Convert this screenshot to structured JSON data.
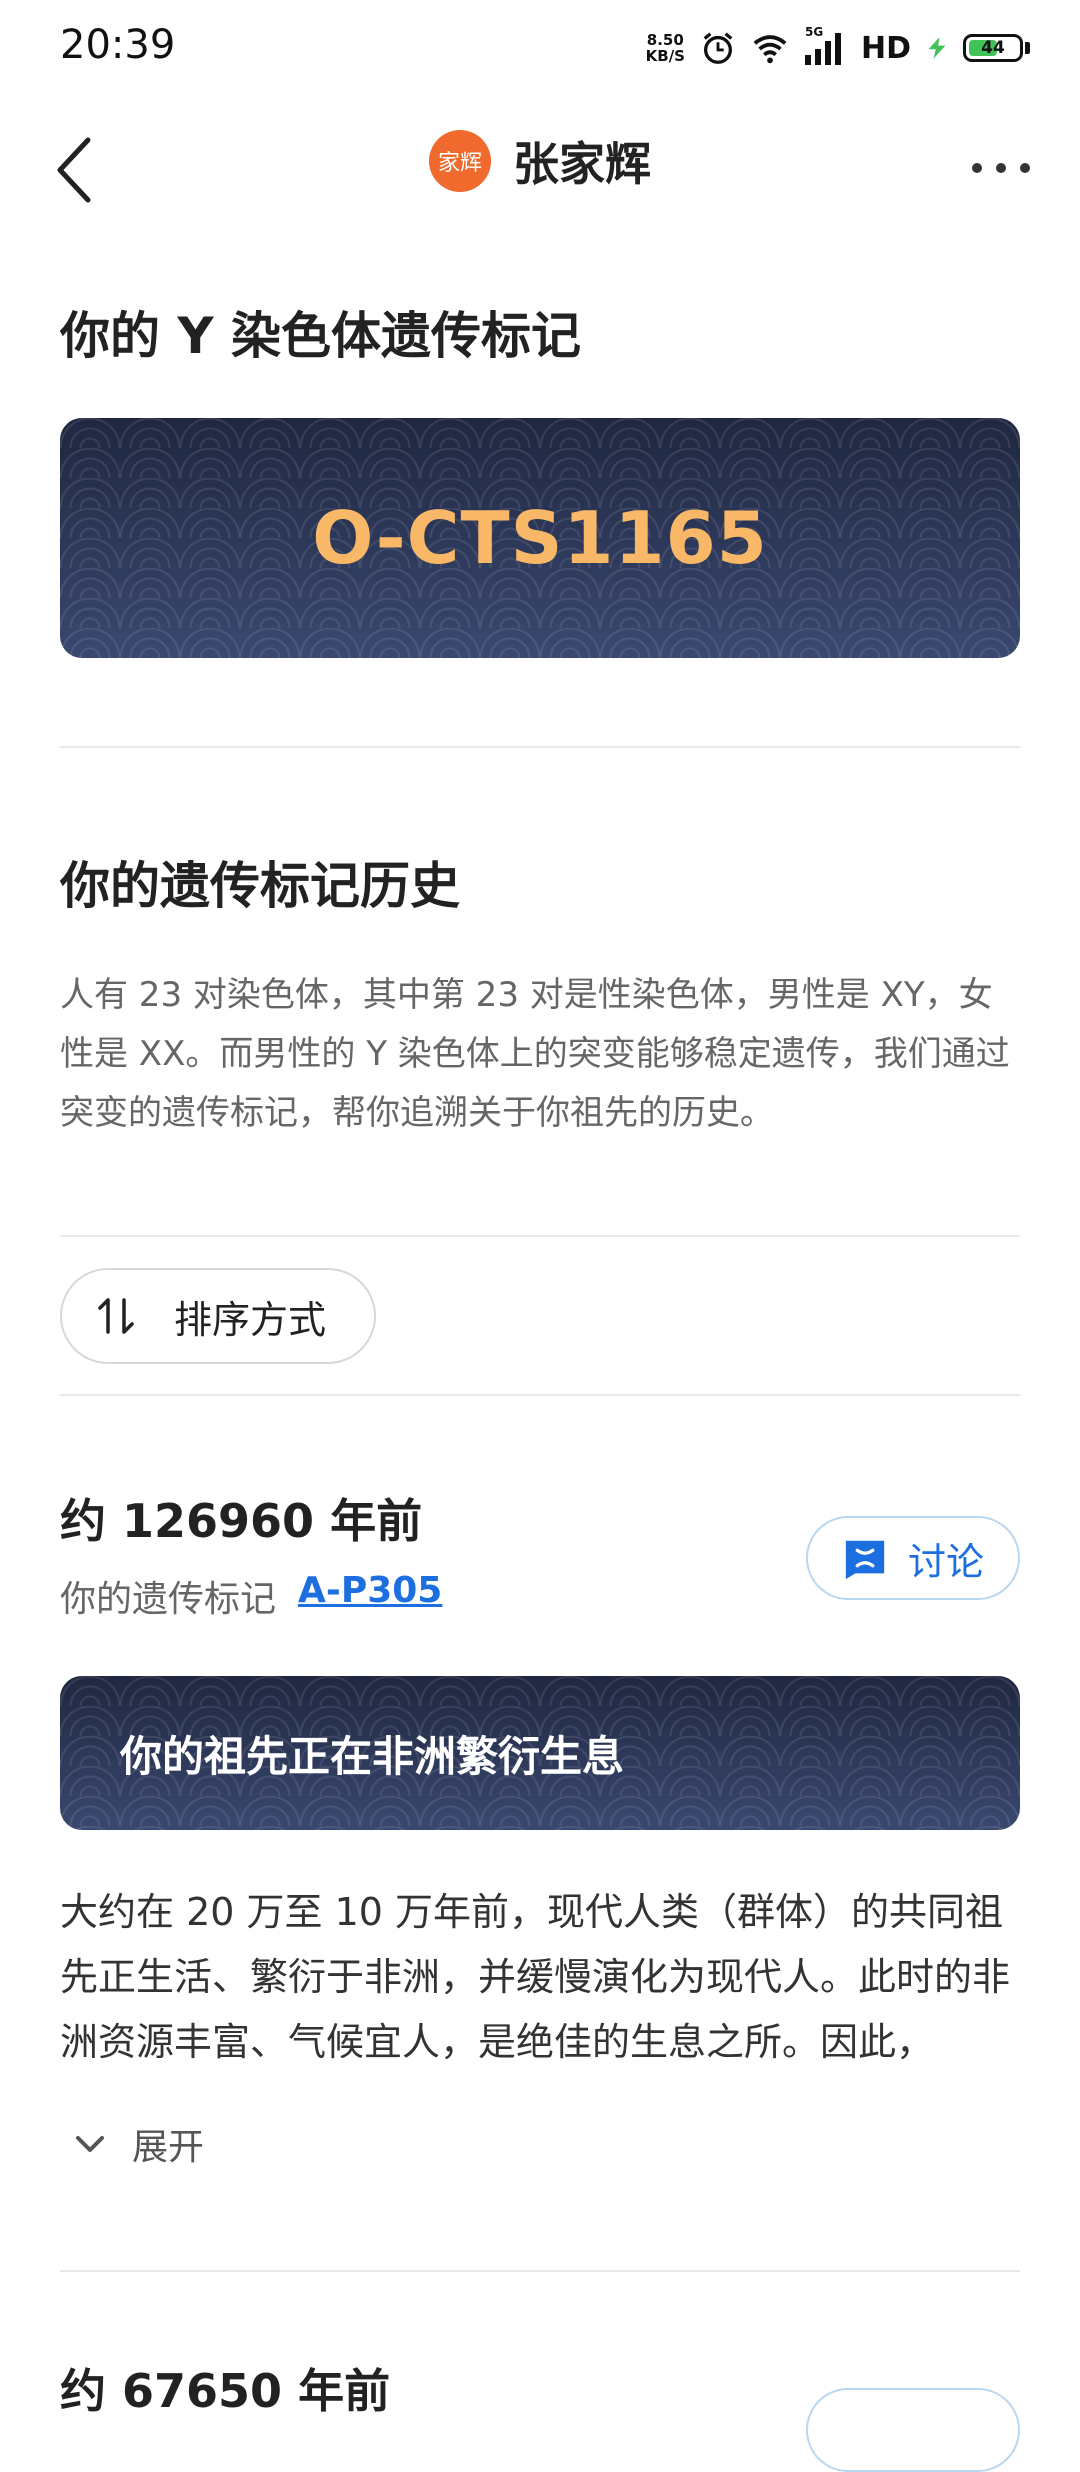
{
  "status_bar": {
    "time": "20:39",
    "net_speed_value": "8.50",
    "net_speed_unit": "KB/S",
    "network_label": "5G",
    "hd_label": "HD",
    "battery_level": "44"
  },
  "header": {
    "logo_text": "家辉",
    "title": "张家辉"
  },
  "y_marker": {
    "heading": "你的 Y 染色体遗传标记",
    "marker": "O-CTS1165"
  },
  "history": {
    "heading": "你的遗传标记历史",
    "description": "人有 23 对染色体，其中第 23 对是性染色体，男性是 XY，女性是 XX。而男性的 Y 染色体上的突变能够稳定遗传，我们通过突变的遗传标记，帮你追溯关于你祖先的历史。",
    "sort_label": "排序方式"
  },
  "entries": [
    {
      "time_ago": "约 126960 年前",
      "marker_prefix": "你的遗传标记",
      "marker_link": "A-P305",
      "discuss_label": "讨论",
      "story_title": "你的祖先正在非洲繁衍生息",
      "story_text": "大约在 20 万至 10 万年前，现代人类（群体）的共同祖先正生活、繁衍于非洲，并缓慢演化为现代人。此时的非洲资源丰富、气候宜人，是绝佳的生息之所。因此，",
      "expand_label": "展开"
    },
    {
      "time_ago": "约 67650 年前"
    }
  ],
  "colors": {
    "accent_link": "#1d6fe0",
    "marker_gold": "#f8b867",
    "banner_dark": "#2c3652",
    "logo_orange": "#ef6a2c"
  }
}
